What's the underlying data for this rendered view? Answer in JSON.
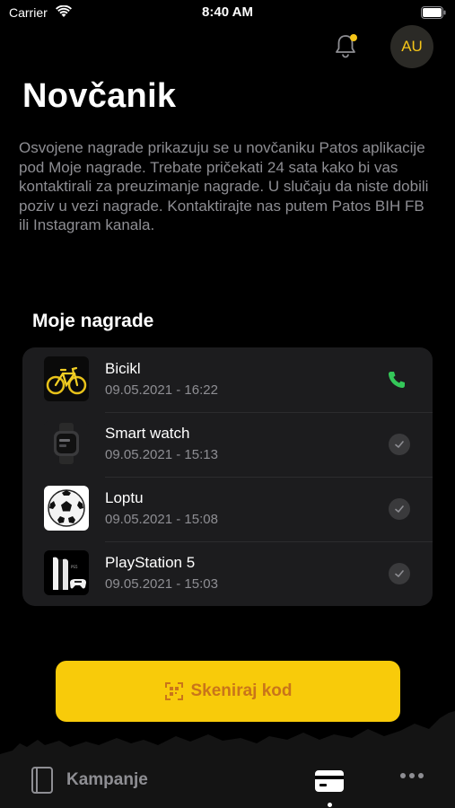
{
  "status_bar": {
    "carrier": "Carrier",
    "time": "8:40 AM"
  },
  "header": {
    "avatar_initials": "AU",
    "has_notification": true
  },
  "page": {
    "title": "Novčanik",
    "info": "Osvojene nagrade prikazuju se u novčaniku Patos aplikacije pod Moje nagrade. Trebate pričekati 24 sata kako bi vas kontaktirali za preuzimanje nagrade. U slučaju da niste dobili poziv u vezi nagrade. Kontaktirajte nas putem Patos BIH FB ili Instagram kanala."
  },
  "rewards": {
    "title": "Moje nagrade",
    "items": [
      {
        "name": "Bicikl",
        "date": "09.05.2021 - 16:22",
        "status_icon": "phone-icon"
      },
      {
        "name": "Smart watch",
        "date": "09.05.2021 - 15:13",
        "status_icon": "check-icon"
      },
      {
        "name": "Loptu",
        "date": "09.05.2021 - 15:08",
        "status_icon": "check-icon"
      },
      {
        "name": "PlayStation 5",
        "date": "09.05.2021 - 15:03",
        "status_icon": "check-icon"
      }
    ]
  },
  "scan_button": {
    "label": "Skeniraj kod"
  },
  "tab_bar": {
    "campaigns_label": "Kampanje",
    "active_tab": "wallet"
  },
  "colors": {
    "accent": "#f8cb0a",
    "scan_text": "#c9751a",
    "phone_green": "#34c759",
    "notification_dot": "#f5c518"
  }
}
